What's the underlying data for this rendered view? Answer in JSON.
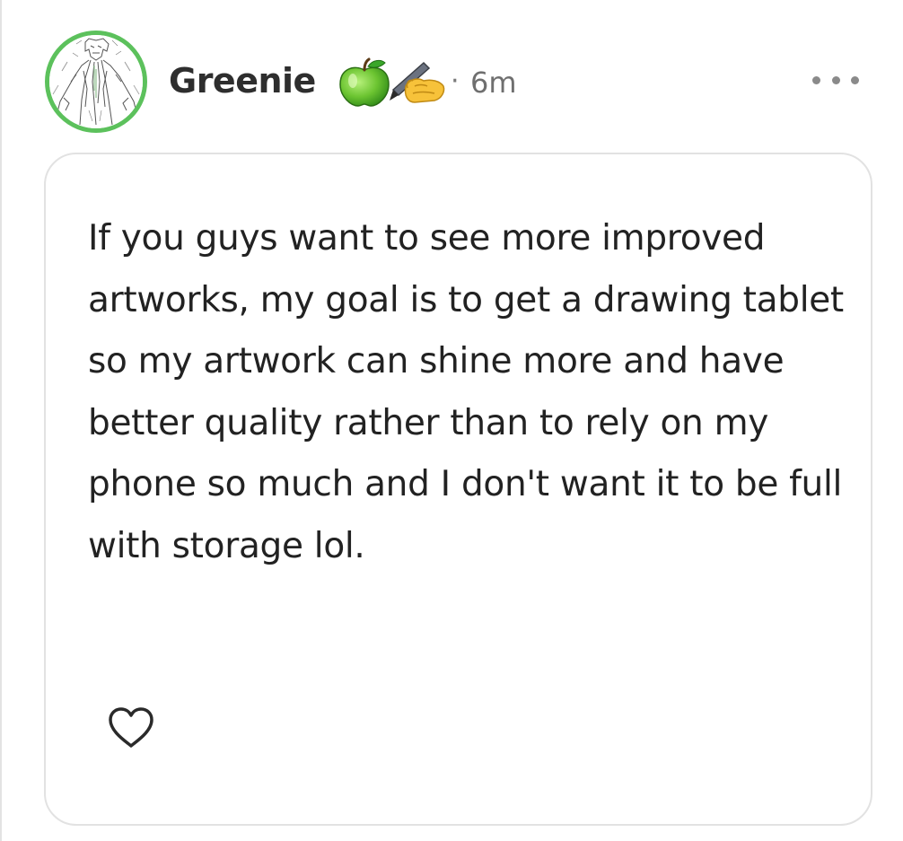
{
  "post": {
    "author": {
      "name": "Greenie",
      "badges": [
        "green-apple-icon",
        "writing-hand-icon"
      ],
      "avatar_ring_color": "#5cc15c"
    },
    "separator": "·",
    "timestamp": "6m",
    "more_menu": "more-options-icon",
    "body": "If you guys want to see more improved artworks, my goal is to get a drawing tablet so my artwork can shine more and have better quality rather than to rely on my phone so much and I don't want it to be full with storage lol.",
    "actions": {
      "like_icon": "heart-outline-icon"
    }
  }
}
